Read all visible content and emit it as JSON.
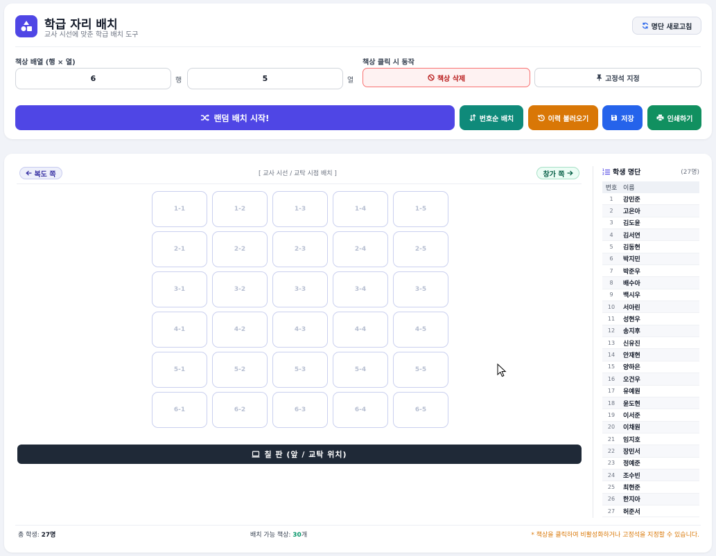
{
  "header": {
    "title": "학급 자리 배치",
    "subtitle": "교사 시선에 맞춘 학급 배치 도구",
    "refresh_label": "명단 새로고침"
  },
  "layout_settings": {
    "label": "책상 배열 (행 × 열)",
    "rows_value": "6",
    "rows_unit": "행",
    "cols_value": "5",
    "cols_unit": "열"
  },
  "click_mode": {
    "label": "책상 클릭 시 동작",
    "delete_label": "책상 삭제",
    "fixed_label": "고정석 지정",
    "active": "delete"
  },
  "actions": {
    "random_label": "랜덤 배치 시작!",
    "number_label": "번호순 배치",
    "history_label": "이력 불러오기",
    "save_label": "저장",
    "print_label": "인쇄하기"
  },
  "classroom": {
    "left_label": "복도 쪽",
    "right_label": "창가 쪽",
    "view_label": "[ 교사 시선 / 교탁 시점 배치 ]",
    "blackboard_label": "칠 판 (앞 / 교탁 위치)",
    "desks": [
      [
        "1-1",
        "1-2",
        "1-3",
        "1-4",
        "1-5"
      ],
      [
        "2-1",
        "2-2",
        "2-3",
        "2-4",
        "2-5"
      ],
      [
        "3-1",
        "3-2",
        "3-3",
        "3-4",
        "3-5"
      ],
      [
        "4-1",
        "4-2",
        "4-3",
        "4-4",
        "4-5"
      ],
      [
        "5-1",
        "5-2",
        "5-3",
        "5-4",
        "5-5"
      ],
      [
        "6-1",
        "6-2",
        "6-3",
        "6-4",
        "6-5"
      ]
    ]
  },
  "roster": {
    "title": "학생 명단",
    "count": "(27명)",
    "col_number": "번호",
    "col_name": "이름",
    "students": [
      {
        "no": "1",
        "name": "강민준"
      },
      {
        "no": "2",
        "name": "고은아"
      },
      {
        "no": "3",
        "name": "김도윤"
      },
      {
        "no": "4",
        "name": "김서연"
      },
      {
        "no": "5",
        "name": "김동현"
      },
      {
        "no": "6",
        "name": "박지민"
      },
      {
        "no": "7",
        "name": "박준우"
      },
      {
        "no": "8",
        "name": "배수아"
      },
      {
        "no": "9",
        "name": "백시우"
      },
      {
        "no": "10",
        "name": "서아린"
      },
      {
        "no": "11",
        "name": "성현우"
      },
      {
        "no": "12",
        "name": "송지후"
      },
      {
        "no": "13",
        "name": "신유진"
      },
      {
        "no": "14",
        "name": "안재현"
      },
      {
        "no": "15",
        "name": "양하은"
      },
      {
        "no": "16",
        "name": "오건우"
      },
      {
        "no": "17",
        "name": "유예원"
      },
      {
        "no": "18",
        "name": "윤도현"
      },
      {
        "no": "19",
        "name": "이서준"
      },
      {
        "no": "20",
        "name": "이채원"
      },
      {
        "no": "21",
        "name": "임지호"
      },
      {
        "no": "22",
        "name": "장민서"
      },
      {
        "no": "23",
        "name": "정예준"
      },
      {
        "no": "24",
        "name": "조수빈"
      },
      {
        "no": "25",
        "name": "최현준"
      },
      {
        "no": "26",
        "name": "한지아"
      },
      {
        "no": "27",
        "name": "허준서"
      }
    ]
  },
  "footer": {
    "total_label": "총 학생: ",
    "total_value": "27명",
    "available_label": "배치 가능 책상: ",
    "available_value": "30",
    "available_unit": "개",
    "note": "* 책상을 클릭하여 비활성화하거나 고정석을 지정할 수 있습니다."
  },
  "colors": {
    "primary": "#4f46e5",
    "teal": "#0f8a7a",
    "orange": "#d97706",
    "blue": "#2563eb",
    "green": "#119060",
    "danger": "#b91c1c",
    "blackboard": "#1f2937"
  }
}
